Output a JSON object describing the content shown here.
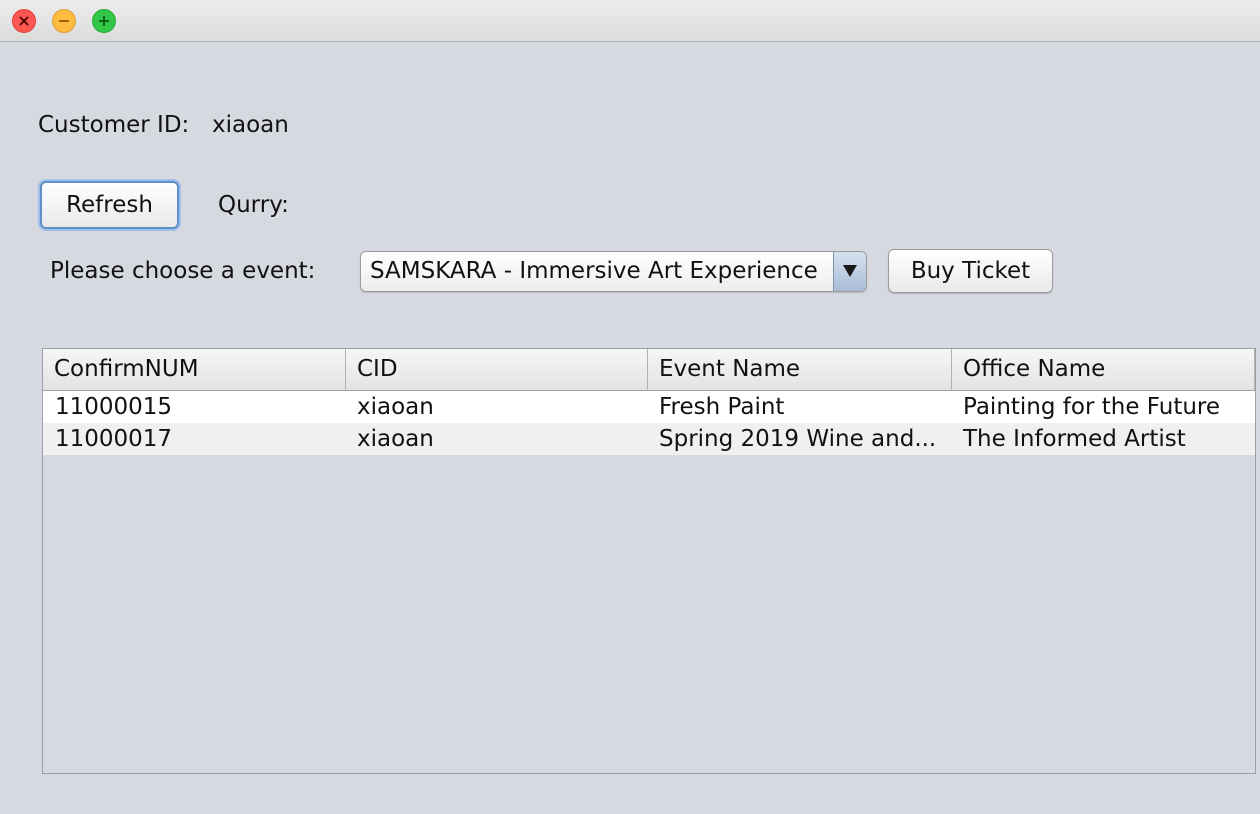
{
  "window": {
    "controls": [
      "close-icon",
      "minimize-icon",
      "maximize-icon"
    ],
    "colors": {
      "close": "#fc5753",
      "minimize": "#fdbc40",
      "maximize": "#33c748",
      "background": "#d6d9e0"
    }
  },
  "customer": {
    "label": "Customer ID:",
    "value": "xiaoan"
  },
  "toolbar": {
    "refresh_label": "Refresh",
    "query_label": "Qurry:"
  },
  "event_picker": {
    "label": "Please choose a event:",
    "selected": "SAMSKARA - Immersive Art Experience",
    "buy_label": "Buy Ticket"
  },
  "table": {
    "columns": [
      "ConfirmNUM",
      "CID",
      "Event Name",
      "Office Name"
    ],
    "rows": [
      [
        "11000015",
        "xiaoan",
        "Fresh Paint",
        "Painting for the Future"
      ],
      [
        "11000017",
        "xiaoan",
        "Spring 2019 Wine and...",
        "The Informed Artist"
      ]
    ]
  }
}
